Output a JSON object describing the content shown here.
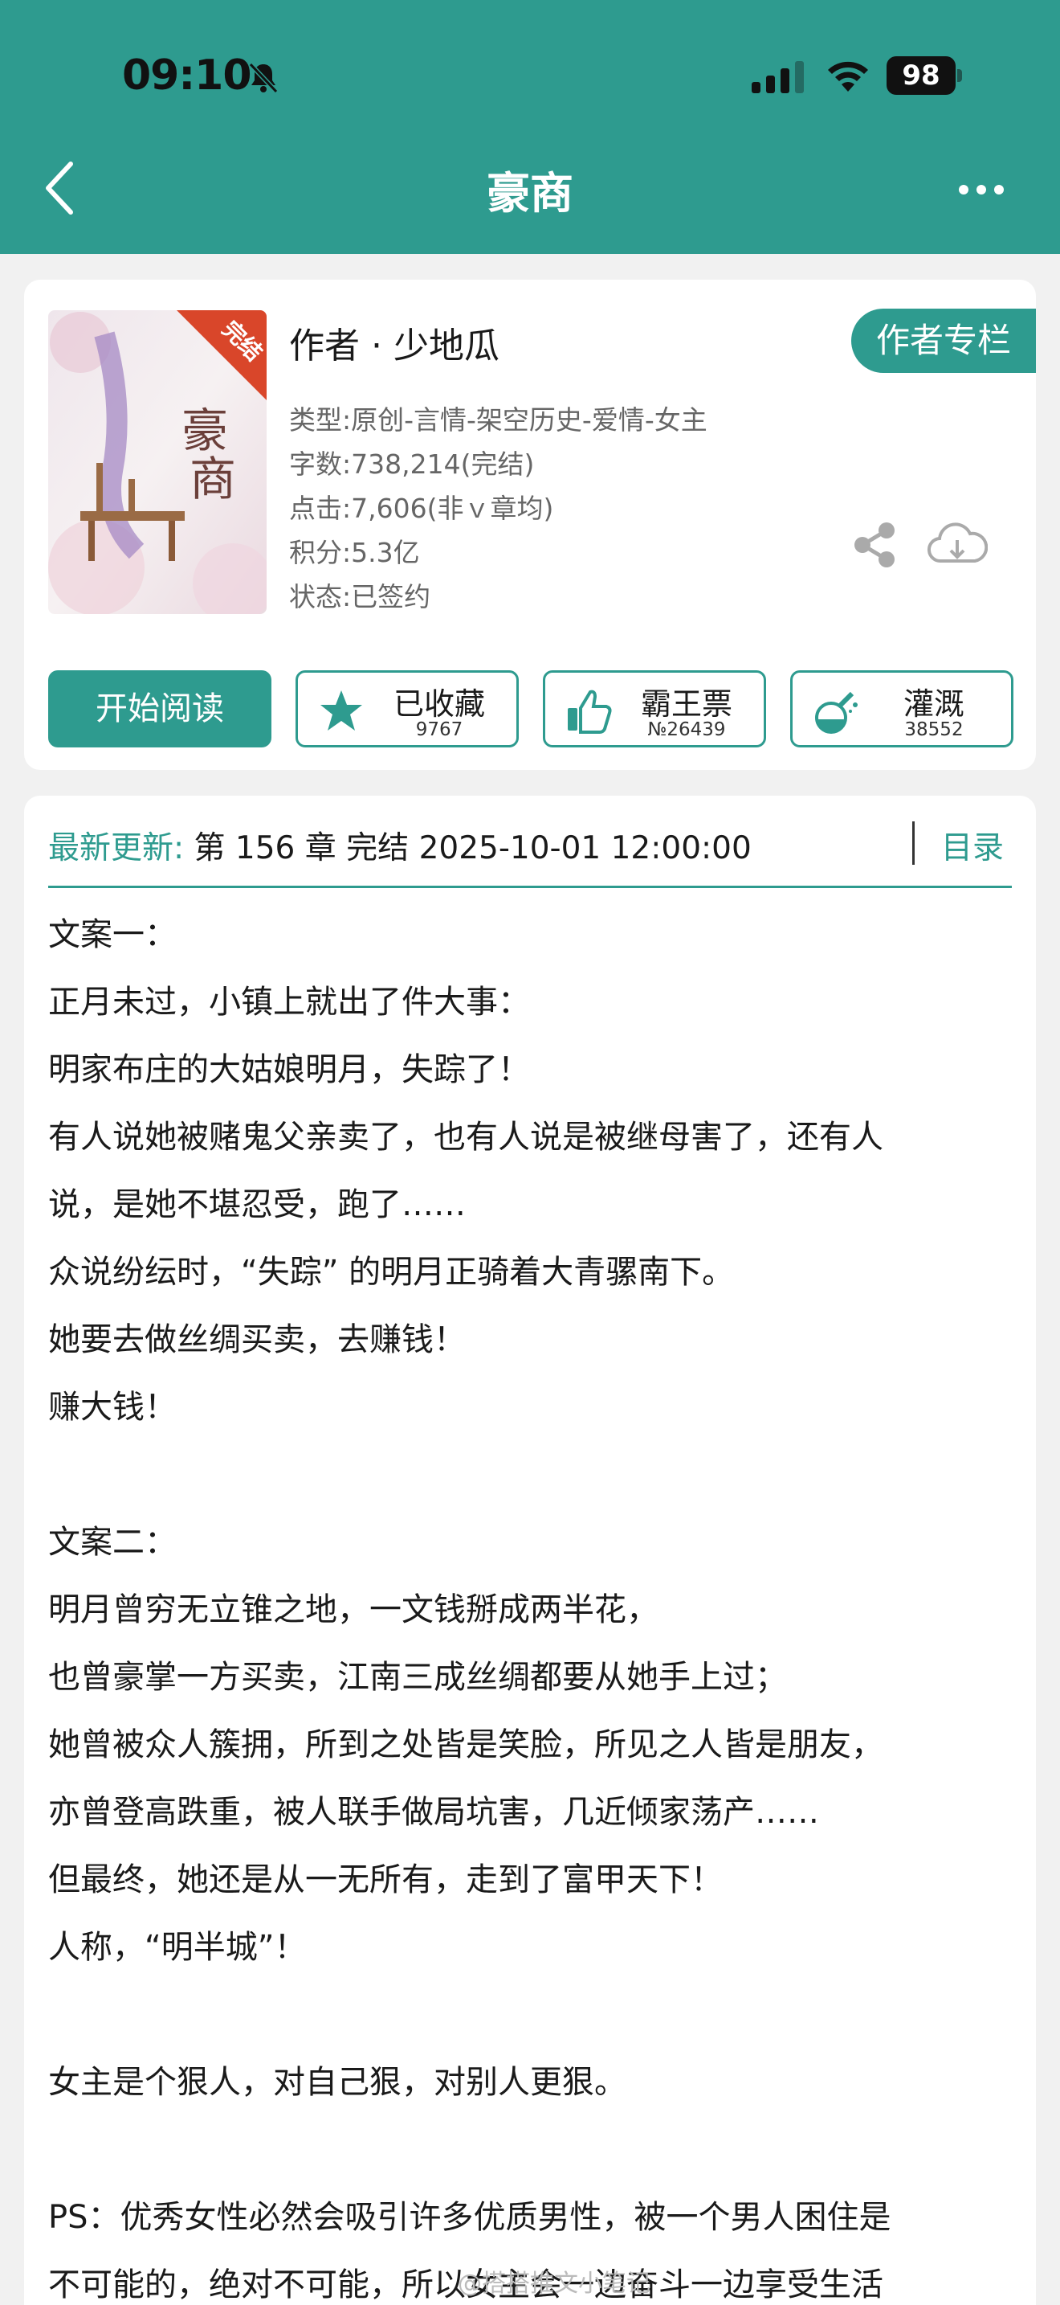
{
  "status_bar": {
    "time": "09:10",
    "battery": "98"
  },
  "nav": {
    "title": "豪商"
  },
  "book": {
    "cover_badge": "完结",
    "cover_title": "豪商",
    "author": "作者 · 少地瓜",
    "author_column_button": "作者专栏",
    "meta": [
      "类型:原创-言情-架空历史-爱情-女主",
      "字数:738,214(完结)",
      "点击:7,606(非ｖ章均)",
      "积分:5.3亿",
      "状态:已签约"
    ],
    "read_button": "开始阅读",
    "stats": [
      {
        "label": "已收藏",
        "value": "9767",
        "icon": "star-icon"
      },
      {
        "label": "霸王票",
        "value": "№26439",
        "icon": "thumbs-up-icon"
      },
      {
        "label": "灌溉",
        "value": "38552",
        "icon": "flask-icon"
      }
    ]
  },
  "update": {
    "label": "最新更新:",
    "text": " 第 156 章 完结 2025-10-01 12:00:00",
    "toc": "目录"
  },
  "synopsis": [
    "文案一：",
    "正月未过，小镇上就出了件大事：",
    "明家布庄的大姑娘明月，失踪了！",
    "有人说她被赌鬼父亲卖了，也有人说是被继母害了，还有人",
    "说，是她不堪忍受，跑了……",
    "众说纷纭时，“失踪” 的明月正骑着大青骡南下。",
    "她要去做丝绸买卖，去赚钱！",
    "赚大钱！",
    "",
    "文案二：",
    "明月曾穷无立锥之地，一文钱掰成两半花，",
    "也曾豪掌一方买卖，江南三成丝绸都要从她手上过；",
    "她曾被众人簇拥，所到之处皆是笑脸，所见之人皆是朋友，",
    "亦曾登高跌重，被人联手做局坑害，几近倾家荡产……",
    "但最终，她还是从一无所有，走到了富甲天下！",
    "人称，“明半城”！",
    "",
    "女主是个狠人，对自己狠，对别人更狠。",
    "",
    "PS：优秀女性必然会吸引许多优质男性，被一个男人困住是",
    "不可能的，绝对不可能，所以女主会一边奋斗一边享受生活"
  ],
  "watermark": "@搭搭推文小笔记"
}
